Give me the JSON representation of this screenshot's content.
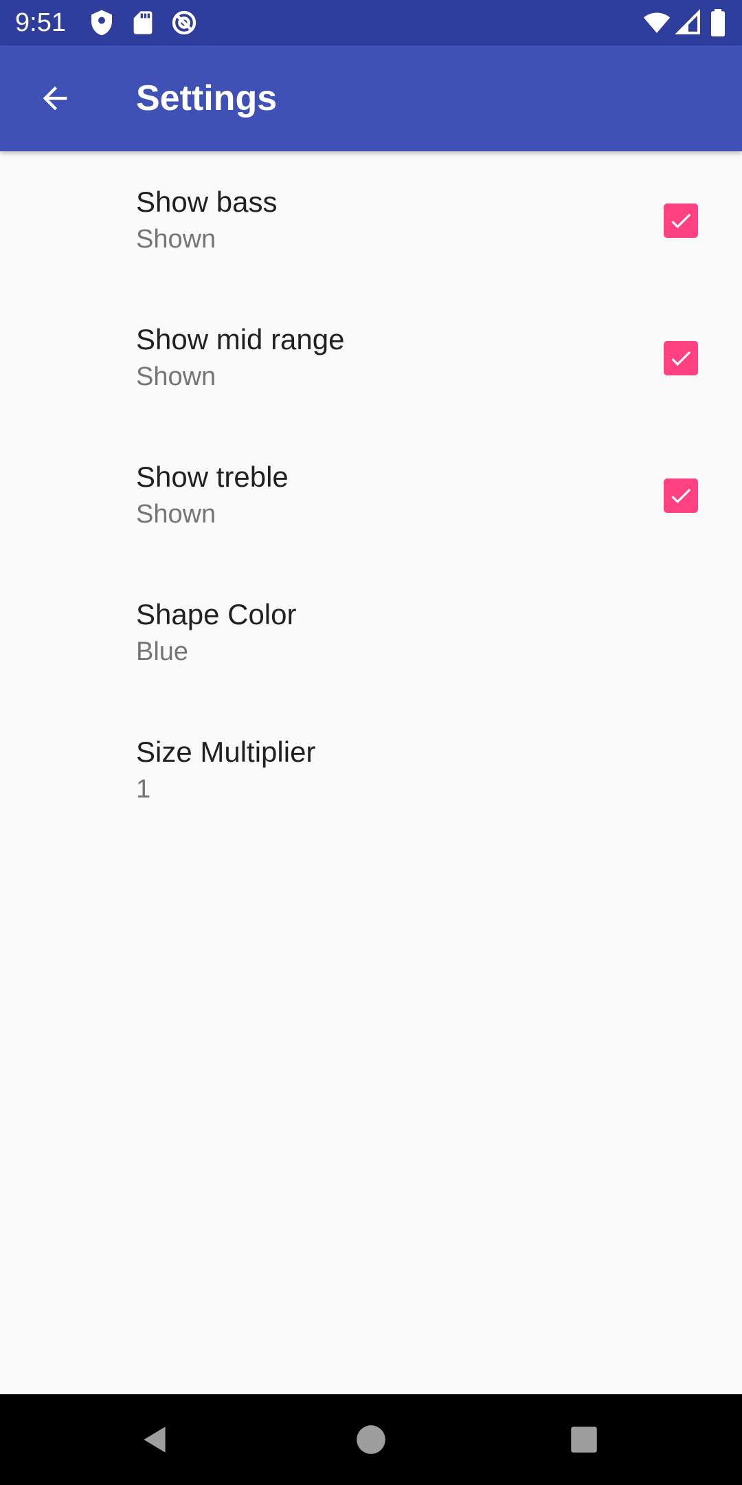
{
  "status_bar": {
    "time": "9:51",
    "left_icons": [
      "shield-icon",
      "sd-card-icon",
      "sync-disabled-icon"
    ],
    "right_icons": [
      "wifi-icon",
      "cellular-signal-icon",
      "battery-icon"
    ]
  },
  "app_bar": {
    "title": "Settings",
    "back_icon": "arrow-back-icon",
    "background_color": "#3f51b5"
  },
  "preferences": [
    {
      "title": "Show bass",
      "summary": "Shown",
      "checkbox": true,
      "checked": true
    },
    {
      "title": "Show mid range",
      "summary": "Shown",
      "checkbox": true,
      "checked": true
    },
    {
      "title": "Show treble",
      "summary": "Shown",
      "checkbox": true,
      "checked": true
    },
    {
      "title": "Shape Color",
      "summary": "Blue",
      "checkbox": false
    },
    {
      "title": "Size Multiplier",
      "summary": "1",
      "checkbox": false
    }
  ],
  "accent_color": "#ff4081",
  "nav_bar": {
    "buttons": [
      "back-triangle-icon",
      "home-circle-icon",
      "recents-square-icon"
    ]
  }
}
